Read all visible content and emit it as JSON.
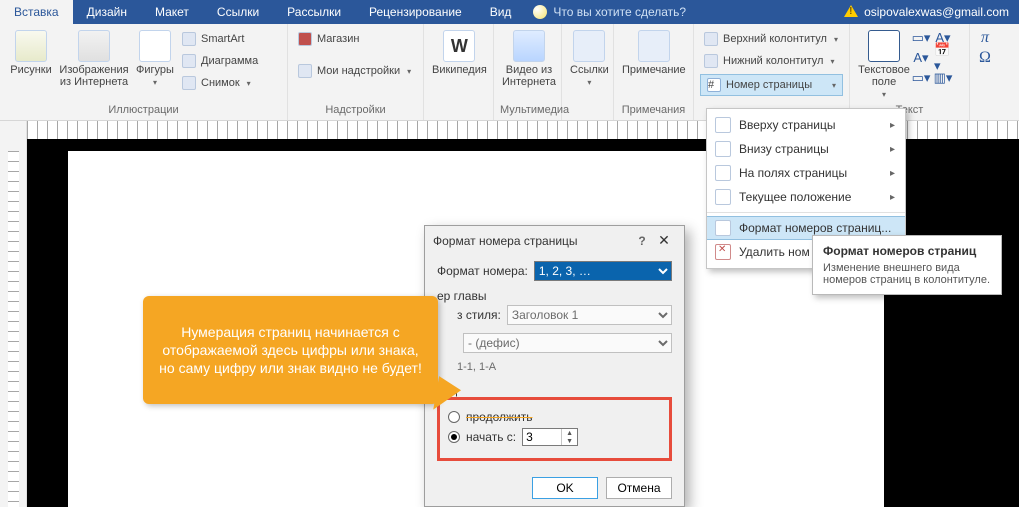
{
  "tabs": [
    "Вставка",
    "Дизайн",
    "Макет",
    "Ссылки",
    "Рассылки",
    "Рецензирование",
    "Вид"
  ],
  "tell_me": "Что вы хотите сделать?",
  "account": "osipovalexwas@gmail.com",
  "ribbon": {
    "illustrations": {
      "label": "Иллюстрации",
      "pictures": "Рисунки",
      "online": "Изображения\nиз Интернета",
      "shapes": "Фигуры",
      "smartart": "SmartArt",
      "chart": "Диаграмма",
      "screenshot": "Снимок"
    },
    "addins": {
      "label": "Надстройки",
      "store": "Магазин",
      "myaddins": "Мои надстройки",
      "wiki": "Википедия"
    },
    "media": {
      "label": "Мультимедиа",
      "video": "Видео из\nИнтернета"
    },
    "links": {
      "label": "",
      "links": "Ссылки"
    },
    "comments": {
      "label": "Примечания",
      "comment": "Примечание"
    },
    "headerfooter": {
      "label": "",
      "header": "Верхний колонтитул",
      "footer": "Нижний колонтитул",
      "pagenum": "Номер страницы"
    },
    "text": {
      "label": "Текст",
      "textbox": "Текстовое\nполе"
    }
  },
  "page_number_menu": {
    "top": "Вверху страницы",
    "bottom": "Внизу страницы",
    "margins": "На полях страницы",
    "current": "Текущее положение",
    "format": "Формат номеров страниц...",
    "remove": "Удалить ном"
  },
  "tooltip": {
    "title": "Формат номеров страниц",
    "body": "Изменение внешнего вида номеров страниц в колонтитуле."
  },
  "dialog": {
    "title": "Формат номера страницы",
    "format_label": "Формат номера:",
    "format_value": "1, 2, 3, …",
    "chapter_label": "ер главы",
    "chapter_style_lbl": "з стиля:",
    "chapter_style": "Заголовок 1",
    "separator_lbl": "",
    "separator": "-   (дефис)",
    "examples": "1-1, 1-A",
    "num_section": "ниц",
    "continue": "продолжить",
    "start_at": "начать с:",
    "start_value": "3",
    "ok": "OK",
    "cancel": "Отмена"
  },
  "callout": "Нумерация страниц начинается с отображаемой здесь цифры или знака, но саму цифру или знак видно не будет!"
}
